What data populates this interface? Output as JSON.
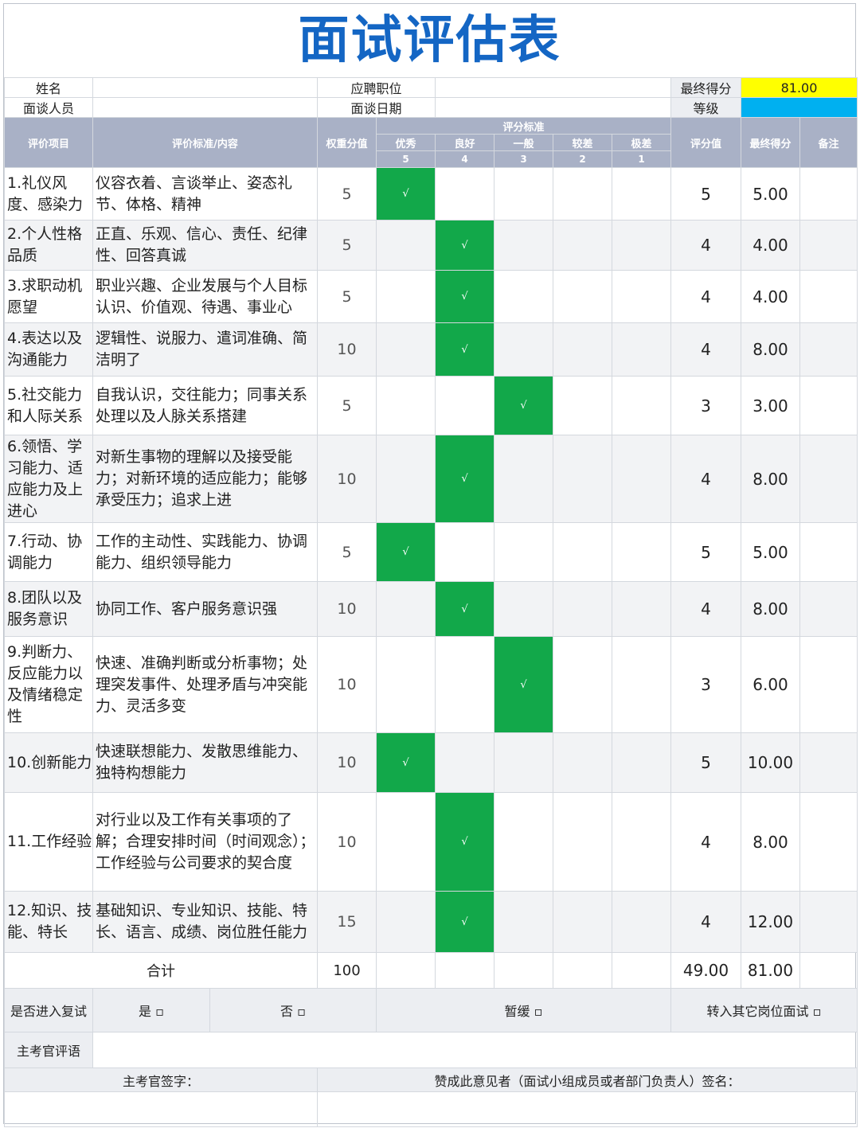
{
  "title": "面试评估表",
  "info": {
    "name_label": "姓名",
    "position_label": "应聘职位",
    "interviewer_label": "面谈人员",
    "date_label": "面谈日期",
    "final_score_label": "最终得分",
    "final_score_value": "81.00",
    "grade_label": "等级",
    "grade_value": ""
  },
  "header": {
    "item": "评价项目",
    "criteria": "评价标准/内容",
    "weight": "权重分值",
    "standard_group": "评分标准",
    "levels": [
      {
        "label": "优秀",
        "score": "5"
      },
      {
        "label": "良好",
        "score": "4"
      },
      {
        "label": "一般",
        "score": "3"
      },
      {
        "label": "较差",
        "score": "2"
      },
      {
        "label": "极差",
        "score": "1"
      }
    ],
    "rating": "评分值",
    "final": "最终得分",
    "note": "备注"
  },
  "check_mark": "√",
  "rows": [
    {
      "item": "1.礼仪风度、感染力",
      "desc": "仪容衣着、言谈举止、姿态礼节、体格、精神",
      "weight": "5",
      "level": 0,
      "rating": "5",
      "final": "5.00"
    },
    {
      "item": "2.个人性格品质",
      "desc": "正直、乐观、信心、责任、纪律性、回答真诚",
      "weight": "5",
      "level": 1,
      "rating": "4",
      "final": "4.00"
    },
    {
      "item": "3.求职动机愿望",
      "desc": "职业兴趣、企业发展与个人目标认识、价值观、待遇、事业心",
      "weight": "5",
      "level": 1,
      "rating": "4",
      "final": "4.00"
    },
    {
      "item": "4.表达以及沟通能力",
      "desc": "逻辑性、说服力、遣词准确、简洁明了",
      "weight": "10",
      "level": 1,
      "rating": "4",
      "final": "8.00"
    },
    {
      "item": "5.社交能力和人际关系",
      "desc": "自我认识，交往能力；同事关系处理以及人脉关系搭建",
      "weight": "5",
      "level": 2,
      "rating": "3",
      "final": "3.00"
    },
    {
      "item": "6.领悟、学习能力、适应能力及上进心",
      "desc": "对新生事物的理解以及接受能力；对新环境的适应能力；能够承受压力；追求上进",
      "weight": "10",
      "level": 1,
      "rating": "4",
      "final": "8.00"
    },
    {
      "item": "7.行动、协调能力",
      "desc": "工作的主动性、实践能力、协调能力、组织领导能力",
      "weight": "5",
      "level": 0,
      "rating": "5",
      "final": "5.00"
    },
    {
      "item": "8.团队以及服务意识",
      "desc": "协同工作、客户服务意识强",
      "weight": "10",
      "level": 1,
      "rating": "4",
      "final": "8.00"
    },
    {
      "item": "9.判断力、反应能力以及情绪稳定性",
      "desc": "快速、准确判断或分析事物；处理突发事件、处理矛盾与冲突能力、灵活多变",
      "weight": "10",
      "level": 2,
      "rating": "3",
      "final": "6.00"
    },
    {
      "item": "10.创新能力",
      "desc": "快速联想能力、发散思维能力、独特构想能力",
      "weight": "10",
      "level": 0,
      "rating": "5",
      "final": "10.00"
    },
    {
      "item": "11.工作经验",
      "desc": "对行业以及工作有关事项的了解；合理安排时间（时间观念）；工作经验与公司要求的契合度",
      "weight": "10",
      "level": 1,
      "rating": "4",
      "final": "8.00"
    },
    {
      "item": "12.知识、技能、特长",
      "desc": "基础知识、专业知识、技能、特长、语言、成绩、岗位胜任能力",
      "weight": "15",
      "level": 1,
      "rating": "4",
      "final": "12.00"
    }
  ],
  "total": {
    "label": "合计",
    "weight": "100",
    "rating": "49.00",
    "final": "81.00"
  },
  "retest": {
    "label": "是否进入复试",
    "yes": "是 ▫",
    "no": "否 ▫",
    "hold": "暂缓 ▫",
    "transfer": "转入其它岗位面试 ▫"
  },
  "comment": {
    "label": "主考官评语",
    "value": ""
  },
  "signature": {
    "examiner": "主考官签字：",
    "approver": "赞成此意见者（面试小组成员或者部门负责人）签名："
  },
  "colors": {
    "title": "#1466c4",
    "header_bg": "#a9b1c6",
    "check_bg": "#12a84a",
    "final_score_bg": "#ffff00",
    "grade_bg": "#00b0f0"
  }
}
